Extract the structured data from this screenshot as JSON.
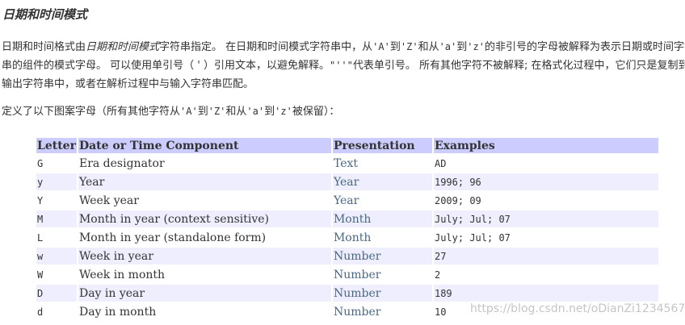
{
  "heading": "日期和时间模式",
  "paragraph": {
    "line1_a": "日期和时间格式由",
    "line1_em": "日期和时间模式",
    "line1_b": "字符串指定。 在日期和时间模式字符串中，从",
    "line1_c1": "'A'",
    "line1_to1": "到",
    "line1_c2": "'Z'",
    "line1_and": "和从",
    "line1_c3": "'a'",
    "line1_to2": "到",
    "line1_c4": "'z'",
    "line1_d": "的非引号的字母被解释为表示日期或时间字符",
    "line2_a": "串的组件的模式字母。 可以使用单引号（ ' ）引用文本，以避免解释。",
    "line2_code": "\"''\"",
    "line2_b": "代表单引号。 所有其他字符不被解释; 在格式化过程中，它们只是复制到",
    "line3": "输出字符串中，或者在解析过程中与输入字符串匹配。"
  },
  "paragraph2": {
    "a": "定义了以下图案字母（所有其他字符从",
    "c1": "'A'",
    "to1": "到",
    "c2": "'Z'",
    "and": "和从",
    "c3": "'a'",
    "to2": "到",
    "c4": "'z'",
    "b": "被保留）："
  },
  "table": {
    "headers": [
      "Letter",
      "Date or Time Component",
      "Presentation",
      "Examples"
    ],
    "rows": [
      {
        "letter": "G",
        "component": "Era designator",
        "presentation": "Text",
        "examples": "AD"
      },
      {
        "letter": "y",
        "component": "Year",
        "presentation": "Year",
        "examples": "1996; 96"
      },
      {
        "letter": "Y",
        "component": "Week year",
        "presentation": "Year",
        "examples": "2009; 09"
      },
      {
        "letter": "M",
        "component": "Month in year (context sensitive)",
        "presentation": "Month",
        "examples": "July; Jul; 07"
      },
      {
        "letter": "L",
        "component": "Month in year (standalone form)",
        "presentation": "Month",
        "examples": "July; Jul; 07"
      },
      {
        "letter": "w",
        "component": "Week in year",
        "presentation": "Number",
        "examples": "27"
      },
      {
        "letter": "W",
        "component": "Week in month",
        "presentation": "Number",
        "examples": "2"
      },
      {
        "letter": "D",
        "component": "Day in year",
        "presentation": "Number",
        "examples": "189"
      },
      {
        "letter": "d",
        "component": "Day in month",
        "presentation": "Number",
        "examples": "10"
      }
    ]
  },
  "watermark": "https://blog.csdn.net/oDianZi1234567"
}
